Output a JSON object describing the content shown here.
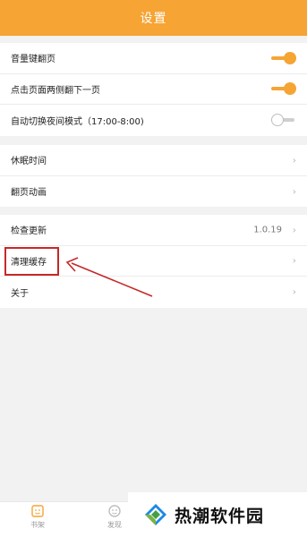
{
  "header": {
    "title": "设置"
  },
  "group1": {
    "items": [
      {
        "label": "音量键翻页",
        "toggle": "on"
      },
      {
        "label": "点击页面两侧翻下一页",
        "toggle": "on"
      },
      {
        "label": "自动切换夜间模式（17:00-8:00)",
        "toggle": "off"
      }
    ]
  },
  "group2": {
    "items": [
      {
        "label": "休眠时间"
      },
      {
        "label": "翻页动画"
      }
    ]
  },
  "group3": {
    "items": [
      {
        "label": "检查更新",
        "value": "1.0.19"
      },
      {
        "label": "清理缓存"
      },
      {
        "label": "关于"
      }
    ]
  },
  "bottom_nav": {
    "items": [
      {
        "label": "书架",
        "icon": "bookshelf-icon"
      },
      {
        "label": "发现",
        "icon": "discover-icon"
      }
    ]
  },
  "watermark": {
    "text": "热潮软件园"
  },
  "colors": {
    "accent": "#f6a434",
    "annotation": "#c62828"
  },
  "icons": {
    "chevron": "›"
  }
}
